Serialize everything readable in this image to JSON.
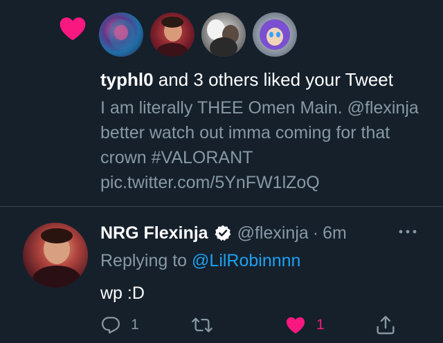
{
  "colors": {
    "background": "#15202b",
    "text_primary": "#ffffff",
    "text_secondary": "#8899a6",
    "link": "#1da1f2",
    "like": "#f91880",
    "divider": "#38444d"
  },
  "like_notification": {
    "icon": "heart-icon",
    "liker_count": 4,
    "username": "typhl0",
    "action_text": " and 3 others liked your Tweet",
    "tweet_text": "I am literally THEE Omen Main. @flexinja better watch out imma coming for that crown #VALORANT pic.twitter.com/5YnFW1lZoQ"
  },
  "reply": {
    "display_name": "NRG Flexinja",
    "verified_icon": "verified-badge-icon",
    "handle": "@flexinja",
    "separator": "·",
    "time": "6m",
    "more_icon": "more-options-icon",
    "replying_prefix": "Replying to ",
    "replying_to": "@LilRobinnnn",
    "text": "wp :D",
    "actions": {
      "reply_count": "1",
      "retweet_count": "",
      "like_count": "1"
    }
  }
}
